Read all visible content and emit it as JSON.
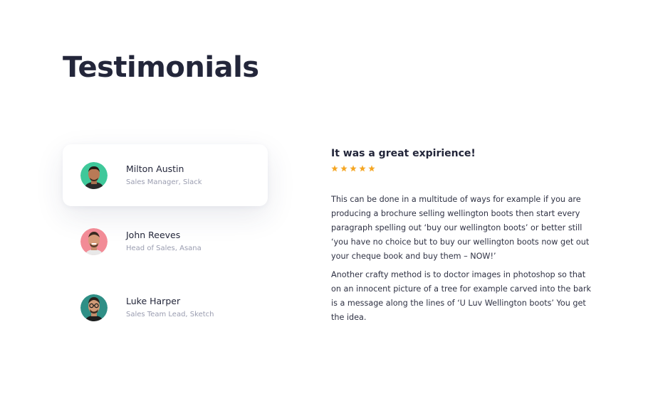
{
  "heading": "Testimonials",
  "people": [
    {
      "name": "Milton Austin",
      "role": "Sales Manager, Slack",
      "avatar_bg": "#3fc89a",
      "active": true
    },
    {
      "name": "John Reeves",
      "role": "Head of Sales, Asana",
      "avatar_bg": "#f28b96",
      "active": false
    },
    {
      "name": "Luke Harper",
      "role": "Sales Team Lead, Sketch",
      "avatar_bg": "#2f8f86",
      "active": false
    }
  ],
  "review": {
    "headline": "It was a great expirience!",
    "rating": 5,
    "star_color": "#f5a623",
    "paragraphs": [
      "This can be done in a multitude of ways for example if you are producing a brochure selling wellington boots then start every paragraph spelling out ‘buy our wellington boots’ or better still ‘you have no choice but to buy our wellington boots now get out your cheque book and buy them – NOW!’",
      "Another crafty method is to doctor images in photoshop so that on an innocent picture of a tree for example carved into the bark is a message along the lines of ‘U Luv Wellington boots’ You get the idea."
    ]
  }
}
